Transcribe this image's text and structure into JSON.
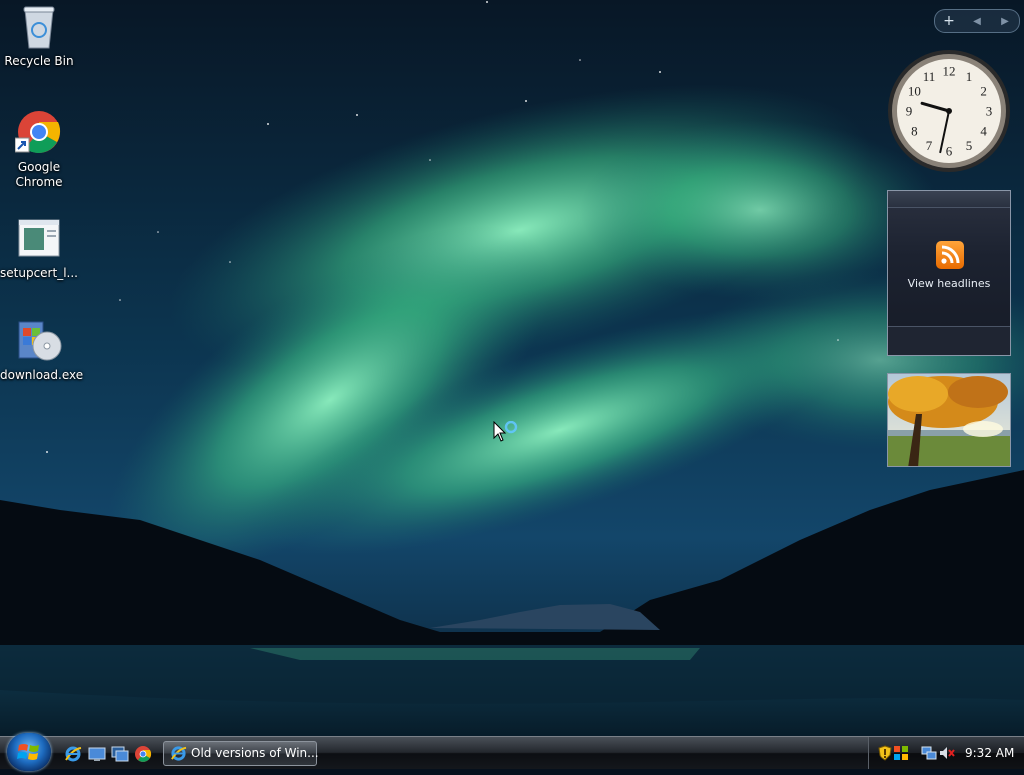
{
  "desktop": {
    "icons": [
      {
        "label": "Recycle Bin"
      },
      {
        "label": "Google Chrome"
      },
      {
        "label": "setupcert_l..."
      },
      {
        "label": "download.exe"
      }
    ]
  },
  "sidebar": {
    "controls": {
      "add": "+",
      "prev": "◀",
      "next": "▶"
    },
    "clock": {
      "hour": 9,
      "minute": 32,
      "numbers": [
        "12",
        "1",
        "2",
        "3",
        "4",
        "5",
        "6",
        "7",
        "8",
        "9",
        "10",
        "11"
      ]
    },
    "feed": {
      "label": "View headlines"
    }
  },
  "taskbar": {
    "start_label": "Start",
    "tasks": [
      {
        "label": "Old versions of Win..."
      }
    ],
    "clock": "9:32 AM"
  },
  "colors": {
    "aurora": "#5fe0a0",
    "sky_top": "#0a1d33",
    "taskbar": "#1a1d22",
    "rss": "#f28a1a"
  }
}
